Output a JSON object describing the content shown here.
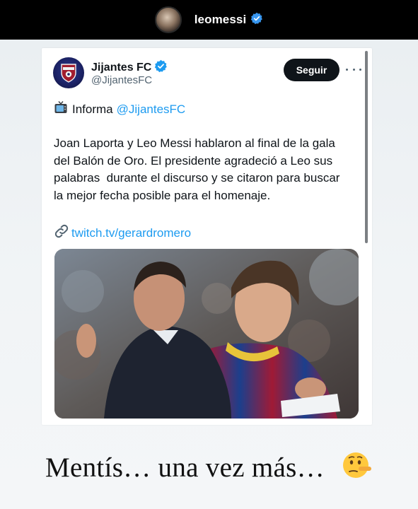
{
  "story": {
    "username": "leomessi",
    "verified": true
  },
  "tweet": {
    "author_name": "Jijantes FC",
    "author_handle": "@JijantesFC",
    "verified": true,
    "follow_label": "Seguir",
    "informa_label": "Informa",
    "informa_mention": "@JijantesFC",
    "body": "Joan Laporta y Leo Messi hablaron al final de la gala\ndel Balón de Oro. El presidente agradeció a Leo sus\npalabras  durante el discurso y se citaron para buscar\nla mejor fecha posible para el homenaje.",
    "link": "twitch.tv/gerardromero"
  },
  "caption": {
    "text": "Mentís… una vez más…"
  },
  "colors": {
    "accent": "#1d9bf0",
    "text": "#0f1419",
    "muted": "#536471",
    "story_bar": "#000000"
  },
  "icons": {
    "tv": "television-icon",
    "link": "link-icon",
    "emoji": "lying-face-emoji"
  }
}
